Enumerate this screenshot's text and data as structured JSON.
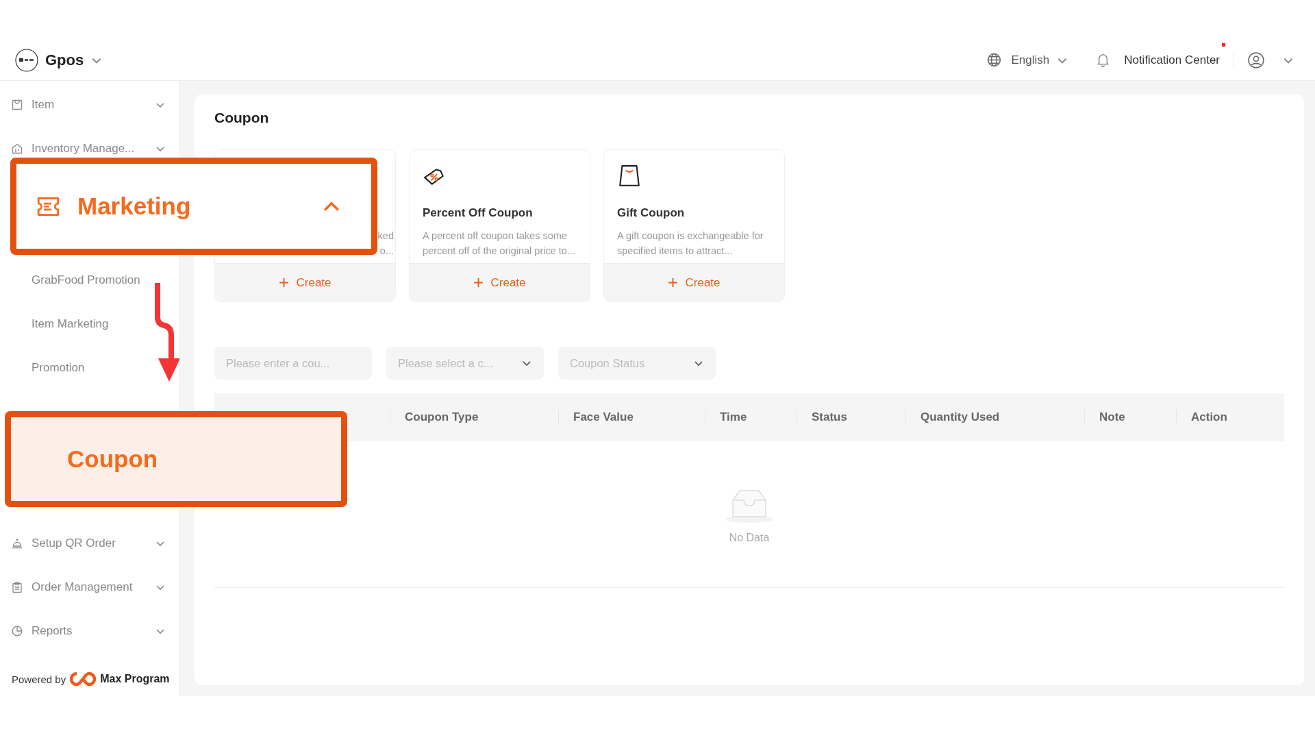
{
  "header": {
    "brand": "Gpos",
    "language": "English",
    "notification": {
      "label": "Notification Center",
      "unread": true
    }
  },
  "sidebar": {
    "groups_above": [
      {
        "label": "Item",
        "expanded": false
      },
      {
        "label": "Inventory Manage...",
        "expanded": false
      }
    ],
    "marketing_children": [
      {
        "label": "GrabFood Promotion"
      },
      {
        "label": "Item Marketing"
      },
      {
        "label": "Promotion"
      }
    ],
    "groups_below": [
      {
        "label": "Setup QR Order",
        "expanded": false
      },
      {
        "label": "Order Management",
        "expanded": false
      },
      {
        "label": "Reports",
        "expanded": false
      }
    ],
    "footer": {
      "prefix": "Powered by",
      "brand": "Max Program"
    }
  },
  "callouts": [
    {
      "kind": "menu-group",
      "label": "Marketing",
      "expanded": true
    },
    {
      "kind": "menu-item",
      "label": "Coupon",
      "selected": true
    }
  ],
  "page": {
    "title": "Coupon",
    "cards": [
      {
        "description": [
          "ked",
          "o..."
        ],
        "action": "Create"
      },
      {
        "title": "Percent Off Coupon",
        "description": [
          "A percent off coupon takes some",
          "percent off of the original price to..."
        ],
        "action": "Create"
      },
      {
        "title": "Gift Coupon",
        "description": [
          "A gift coupon is exchangeable for",
          "specified items to attract..."
        ],
        "action": "Create"
      }
    ],
    "filters": [
      {
        "kind": "input",
        "placeholder": "Please enter a cou..."
      },
      {
        "kind": "select",
        "placeholder": "Please select a c..."
      },
      {
        "kind": "select",
        "placeholder": "Coupon Status"
      }
    ],
    "table": {
      "columns": [
        "",
        "Coupon Type",
        "Face Value",
        "Time",
        "Status",
        "Quantity Used",
        "Note",
        "Action"
      ],
      "empty_text": "No Data"
    }
  }
}
